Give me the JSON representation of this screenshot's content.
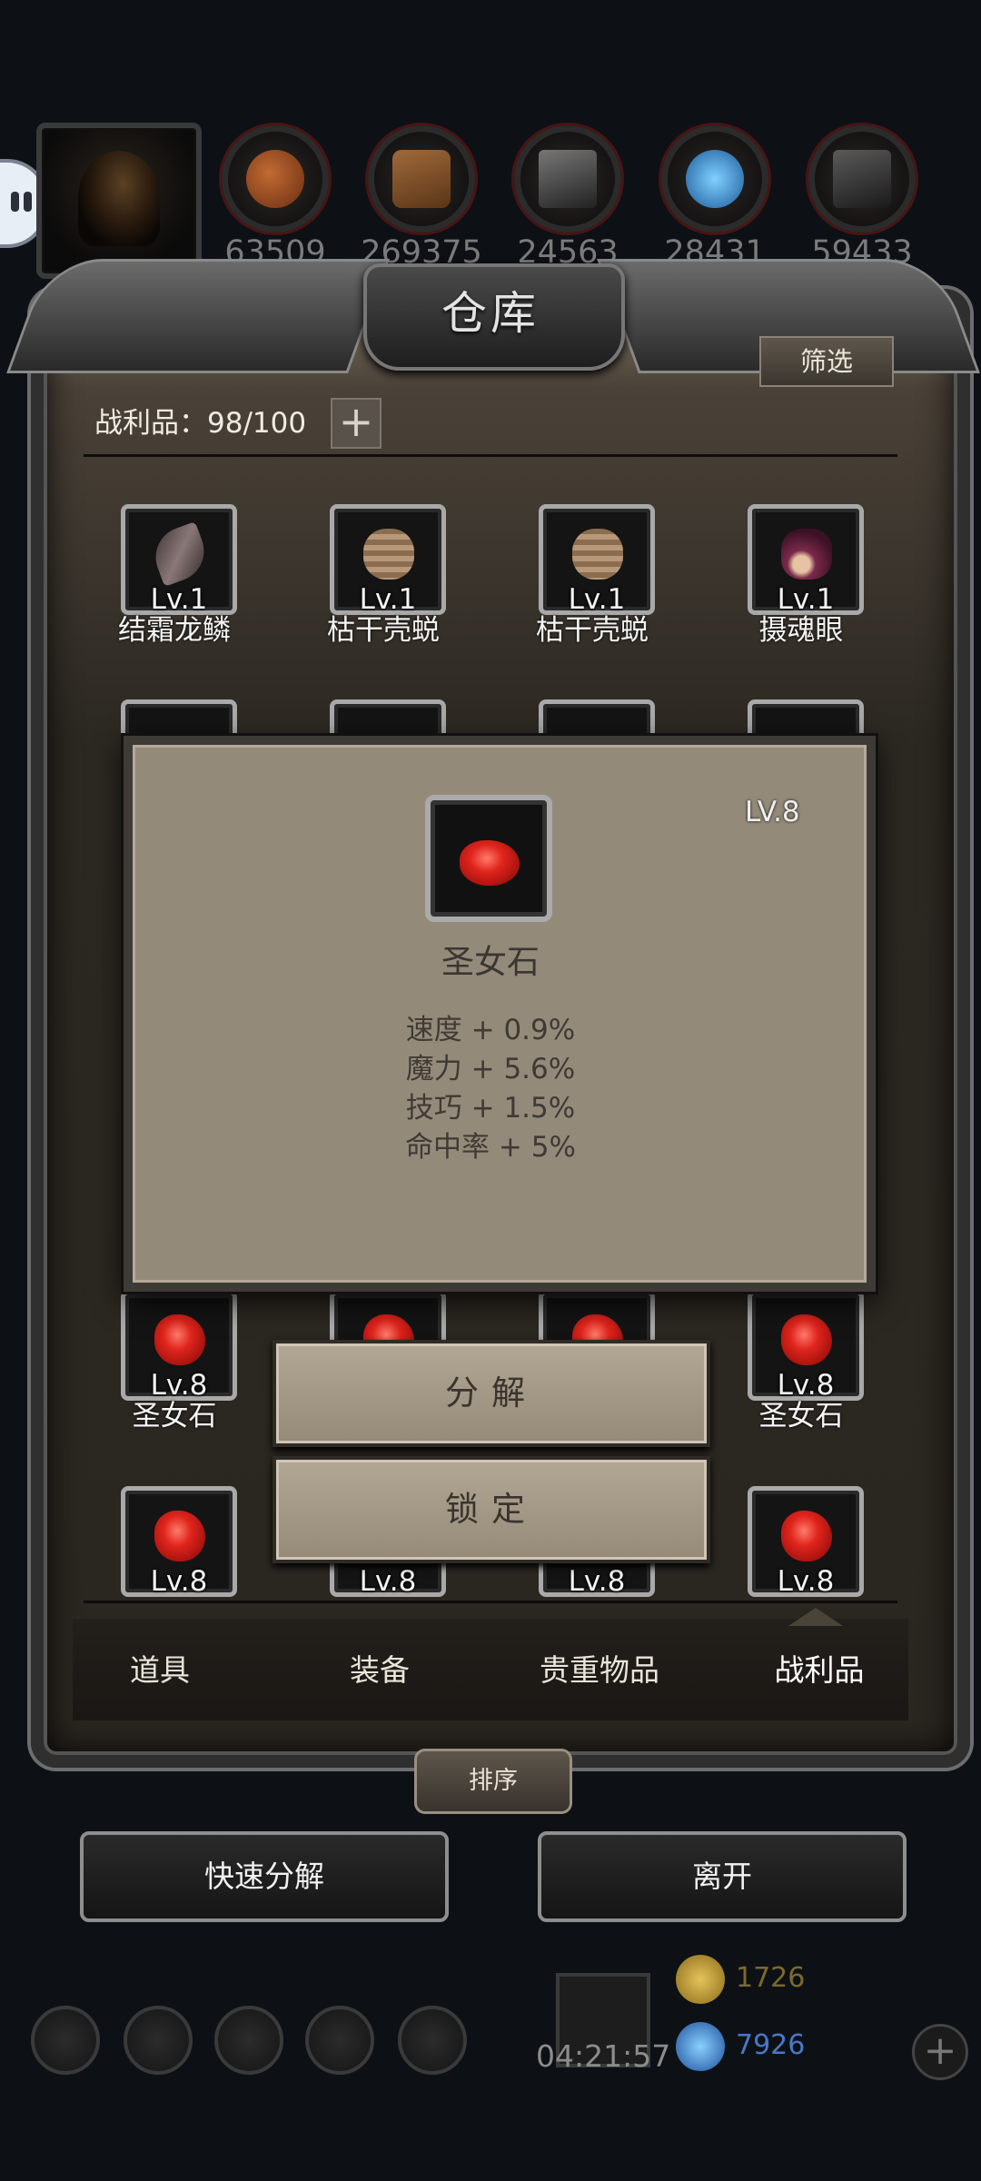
{
  "resources": [
    {
      "icon": "meat-icon",
      "count": "63509"
    },
    {
      "icon": "wood-icon",
      "count": "269375"
    },
    {
      "icon": "iron-icon",
      "count": "24563"
    },
    {
      "icon": "crystal-icon",
      "count": "28431"
    },
    {
      "icon": "stone-icon",
      "count": "59433"
    }
  ],
  "panel": {
    "title": "仓库",
    "filter_label": "筛选",
    "capacity_label": "战利品：98/100",
    "add_label": "+"
  },
  "grid": {
    "row1": [
      {
        "name": "结霜龙鳞",
        "level": "Lv.1",
        "icon": "dragon-scale-icon"
      },
      {
        "name": "枯干壳蜕",
        "level": "Lv.1",
        "icon": "dried-shell-icon"
      },
      {
        "name": "枯干壳蜕",
        "level": "Lv.1",
        "icon": "dried-shell-icon"
      },
      {
        "name": "摄魂眼",
        "level": "Lv.1",
        "icon": "soul-eye-icon"
      }
    ],
    "row4": [
      {
        "name": "圣女石",
        "level": "Lv.8",
        "icon": "saint-stone-icon"
      },
      {
        "name": "",
        "level": "Lv.8",
        "icon": "saint-stone-icon"
      },
      {
        "name": "",
        "level": "Lv.8",
        "icon": "saint-stone-icon"
      },
      {
        "name": "圣女石",
        "level": "Lv.8",
        "icon": "saint-stone-icon"
      }
    ],
    "row5": [
      {
        "level": "Lv.8"
      },
      {
        "level": "Lv.8"
      },
      {
        "level": "Lv.8"
      },
      {
        "level": "Lv.8"
      }
    ]
  },
  "popup": {
    "level": "LV.8",
    "item_name": "圣女石",
    "stats": [
      "速度 + 0.9%",
      "魔力 + 5.6%",
      "技巧 + 1.5%",
      "命中率 + 5%"
    ],
    "decompose_label": "分解",
    "lock_label": "锁定"
  },
  "tabs": [
    "道具",
    "装备",
    "贵重物品",
    "战利品"
  ],
  "active_tab": "战利品",
  "sort_label": "排序",
  "bottom_buttons": {
    "quick_decompose": "快速分解",
    "leave": "离开"
  },
  "dock": {
    "timer": "04:21:57",
    "gold": "1726",
    "gems": "7926"
  },
  "colors": {
    "accent_red": "#d3231b",
    "popup_bg": "#948a7a",
    "gold": "#c9a53a",
    "gem": "#4a8fe0"
  }
}
